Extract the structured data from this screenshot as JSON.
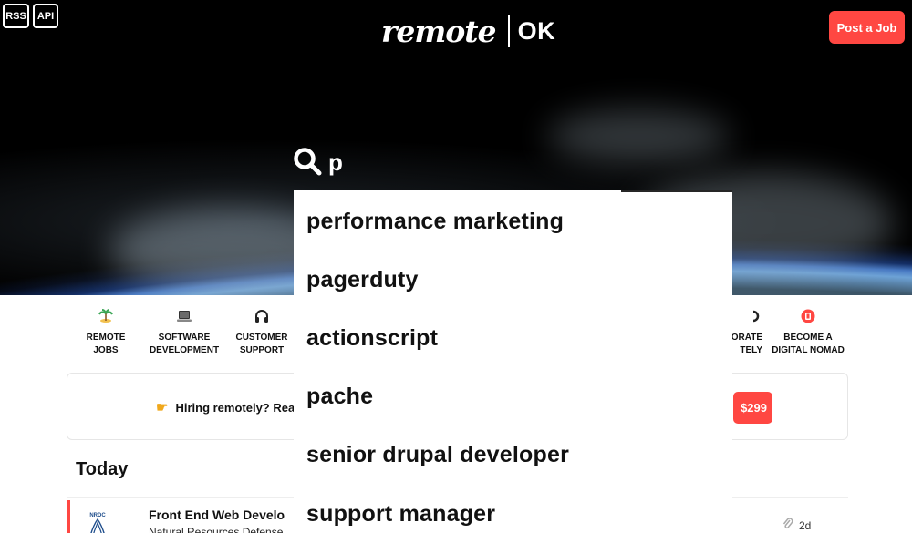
{
  "header": {
    "rss_label": "RSS",
    "api_label": "API",
    "logo_word": "remote",
    "logo_ok": "OK",
    "post_job_label": "Post a Job"
  },
  "search": {
    "value": "p",
    "icon": "search-icon"
  },
  "suggestions": [
    "performance marketing",
    "pagerduty",
    "actionscript",
    "pache",
    "senior drupal developer",
    "support manager"
  ],
  "categories": [
    {
      "label": "REMOTE JOBS",
      "icon": "palm-island-icon"
    },
    {
      "label": "SOFTWARE\nDEVELOPMENT",
      "icon": "laptop-icon"
    },
    {
      "label": "CUSTOMER\nSUPPORT",
      "icon": "headphones-icon"
    },
    {
      "label": "ORATE\nTELY",
      "icon": "partial-icon"
    },
    {
      "label": "BECOME A\nDIGITAL NOMAD",
      "icon": "nomad-badge-icon"
    }
  ],
  "banner": {
    "text": "Hiring remotely? Reach",
    "price_label": "$299",
    "icon": "pointing-hand-icon"
  },
  "section": {
    "title": "Today"
  },
  "job": {
    "title": "Front End Web Develo",
    "company": "Natural Resources Defense",
    "age": "2d",
    "logo_text": "NRDC"
  },
  "colors": {
    "brand_red": "#ff4742",
    "text_dark": "#111111"
  }
}
